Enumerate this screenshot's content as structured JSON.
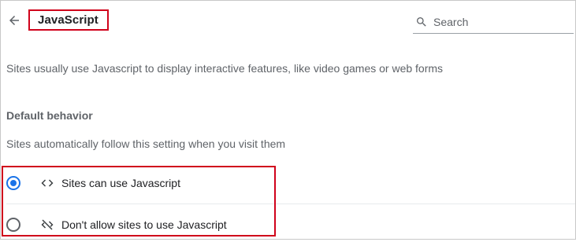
{
  "header": {
    "title": "JavaScript",
    "search_placeholder": "Search"
  },
  "description": "Sites usually use Javascript to display interactive features, like video games or web forms",
  "default_behavior": {
    "heading": "Default behavior",
    "subtitle": "Sites automatically follow this setting when you visit them",
    "options": [
      {
        "label": "Sites can use Javascript",
        "icon": "code-icon",
        "selected": true
      },
      {
        "label": "Don't allow sites to use Javascript",
        "icon": "code-off-icon",
        "selected": false
      }
    ]
  },
  "colors": {
    "accent": "#1a73e8",
    "highlight_border": "#d0021b"
  },
  "icons": {
    "back": "arrow-back-icon",
    "search": "search-icon"
  }
}
